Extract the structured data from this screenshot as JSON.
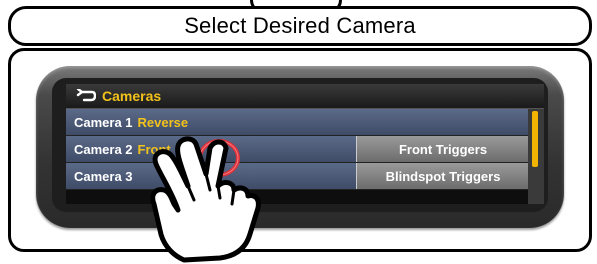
{
  "banner": {
    "title": "Select Desired Camera"
  },
  "screen": {
    "header": {
      "title": "Cameras"
    },
    "rows": [
      {
        "name": "Camera 1",
        "value": "Reverse"
      },
      {
        "name": "Camera 2",
        "value": "Front"
      },
      {
        "name": "Camera 3",
        "value": ""
      }
    ],
    "side_buttons": [
      {
        "label": "Front Triggers"
      },
      {
        "label": "Blindspot Triggers"
      }
    ]
  },
  "colors": {
    "accent": "#f2c21b",
    "row_bg": "#4b5878",
    "touch_ring": "#e0303a"
  },
  "icons": {
    "back": "back-arrow-icon",
    "pointer": "hand-pointer-icon"
  }
}
